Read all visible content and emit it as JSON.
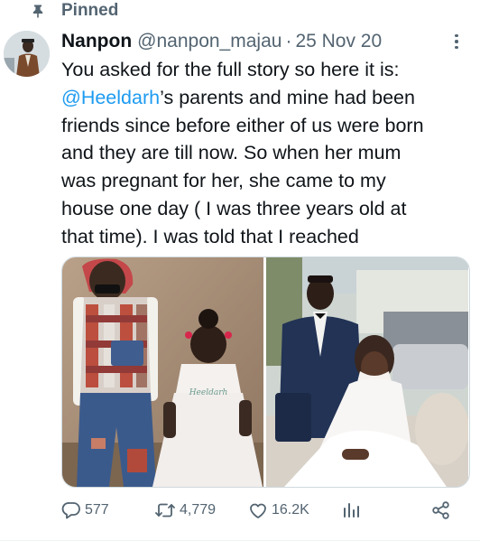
{
  "pinned": {
    "label": "Pinned"
  },
  "tweet": {
    "author_name": "Nanpon",
    "handle": "@nanpon_majau",
    "separator": "·",
    "date": "25 Nov 20",
    "text": {
      "line1": "You asked for the full story so here it is:",
      "mention": "@Heeldarh",
      "line2_rest": "’s parents and mine had been",
      "line3": "friends since before either of us were born",
      "line4": "and they are till now. So when her mum",
      "line5": "was pregnant for her, she came to my",
      "line6": "house one day ( I was three years old at",
      "line7": "that time). I was told that I reached"
    },
    "media": {
      "left_photo_dress_caption": "Heeldarh"
    },
    "actions": {
      "replies": "577",
      "retweets": "4,779",
      "likes": "16.2K"
    }
  },
  "colors": {
    "accent": "#1d9bf0",
    "text_primary": "#0f1419",
    "text_secondary": "#536471",
    "border": "#cfd9de"
  },
  "icons": {
    "pin": "pin-icon",
    "more": "more-dots-icon",
    "reply": "reply-bubble-icon",
    "retweet": "retweet-icon",
    "like": "heart-icon",
    "views": "analytics-bars-icon",
    "share": "share-icon"
  }
}
